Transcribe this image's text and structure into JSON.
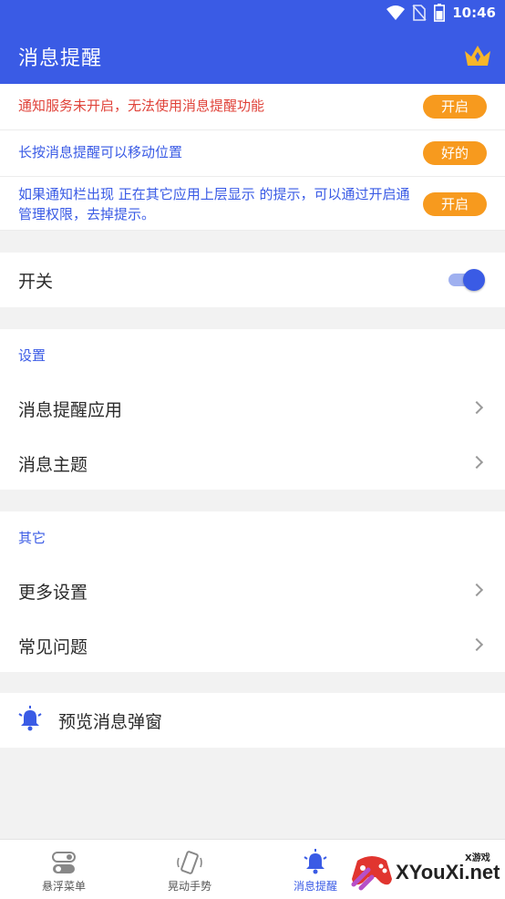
{
  "status_bar": {
    "time": "10:46"
  },
  "app_bar": {
    "title": "消息提醒",
    "crown_icon": "crown-icon"
  },
  "notices": [
    {
      "text": "通知服务未开启，无法使用消息提醒功能",
      "button": "开启",
      "color": "#e0433a"
    },
    {
      "text": "长按消息提醒可以移动位置",
      "button": "好的",
      "color": "#3a5be5"
    },
    {
      "text": "如果通知栏出现 正在其它应用上层显示 的提示，可以通过开启通管理权限，去掉提示。",
      "button": "开启",
      "color": "#3a5be5"
    }
  ],
  "switch_row": {
    "label": "开关",
    "on": true
  },
  "settings": {
    "title": "设置",
    "items": [
      {
        "label": "消息提醒应用"
      },
      {
        "label": "消息主题"
      }
    ]
  },
  "other": {
    "title": "其它",
    "items": [
      {
        "label": "更多设置"
      },
      {
        "label": "常见问题"
      }
    ]
  },
  "preview": {
    "label": "预览消息弹窗",
    "icon": "bell-icon"
  },
  "bottom_nav": [
    {
      "label": "悬浮菜单",
      "icon": "toggle-icon",
      "active": false
    },
    {
      "label": "晃动手势",
      "icon": "shake-phone-icon",
      "active": false
    },
    {
      "label": "消息提醒",
      "icon": "bell-icon",
      "active": true
    }
  ],
  "watermark": {
    "site": "XYouXi.net",
    "tag": "X游戏"
  },
  "colors": {
    "primary": "#3a5be5",
    "accent": "#f79a1e",
    "warning": "#e0433a"
  }
}
